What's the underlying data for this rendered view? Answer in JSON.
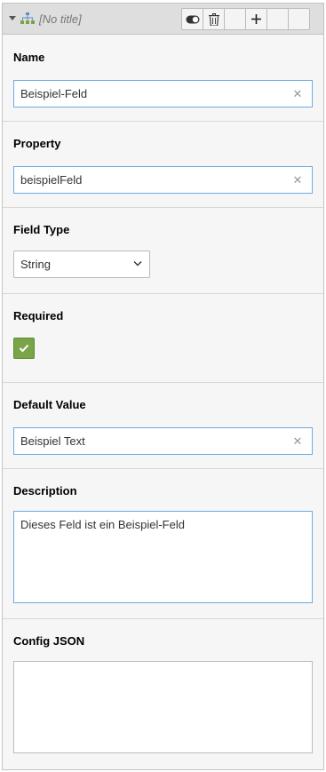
{
  "header": {
    "title": "[No title]",
    "buttons": [
      "toggle-icon",
      "trash-icon",
      "",
      "plus-icon",
      "",
      ""
    ]
  },
  "fields": {
    "name": {
      "label": "Name",
      "value": "Beispiel-Feld"
    },
    "property": {
      "label": "Property",
      "value": "beispielFeld"
    },
    "field_type": {
      "label": "Field Type",
      "value": "String"
    },
    "required": {
      "label": "Required",
      "checked": true
    },
    "default_value": {
      "label": "Default Value",
      "value": "Beispiel Text"
    },
    "description": {
      "label": "Description",
      "value": "Dieses Feld ist ein Beispiel-Feld"
    },
    "config_json": {
      "label": "Config JSON",
      "value": ""
    }
  },
  "colors": {
    "accent_border": "#6daae0",
    "checkbox_green": "#79a548",
    "header_bg": "#dedede"
  }
}
